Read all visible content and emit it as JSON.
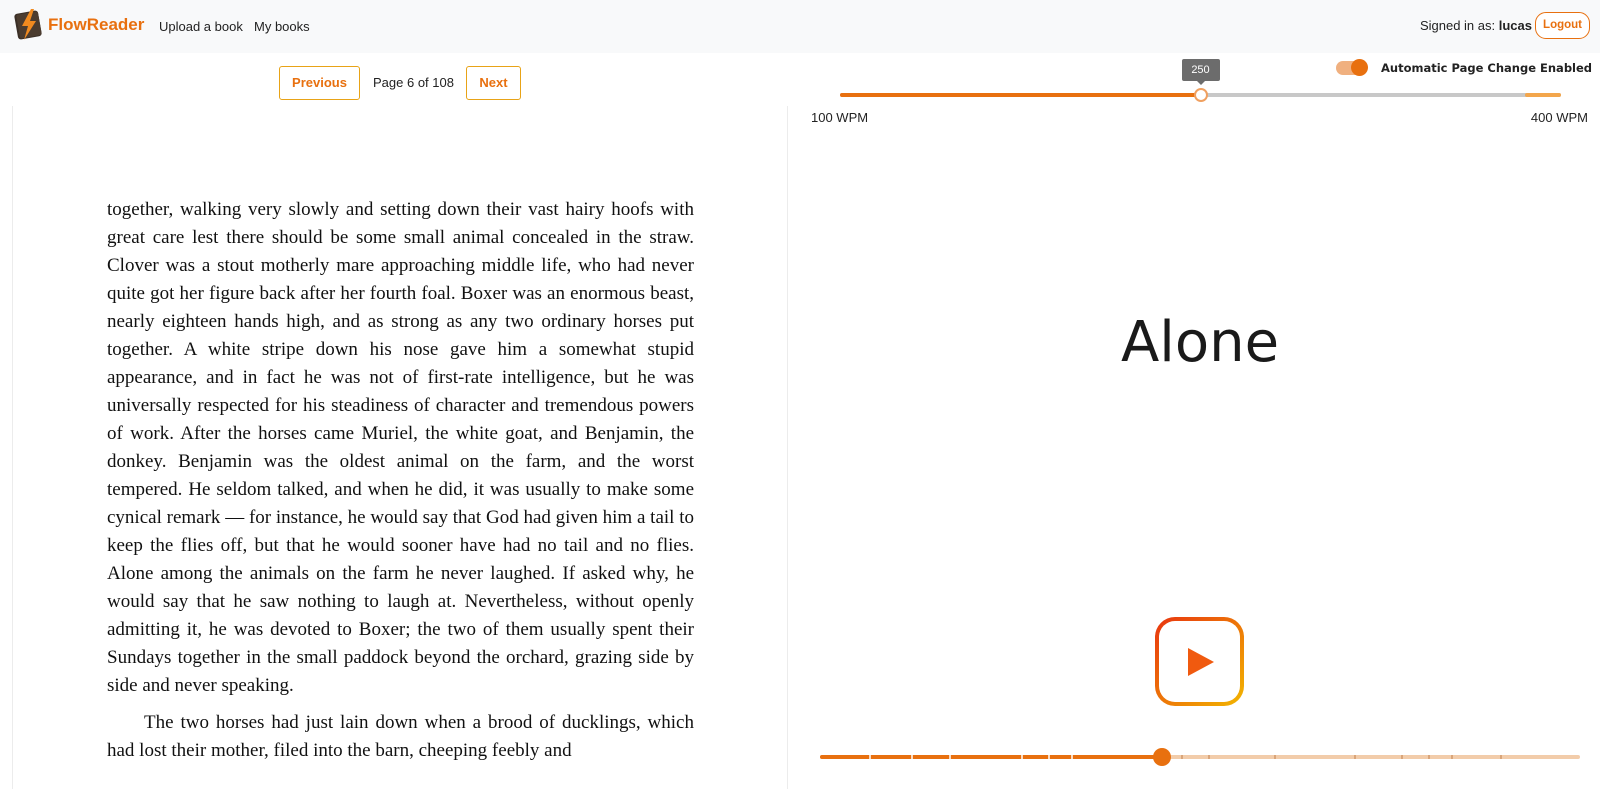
{
  "app": {
    "name": "FlowReader"
  },
  "nav": {
    "upload": "Upload a book",
    "my_books": "My books"
  },
  "user": {
    "signed_in_label": "Signed in as:",
    "username": "lucas",
    "logout_label": "Logout"
  },
  "pager": {
    "previous_label": "Previous",
    "next_label": "Next",
    "page_text": "Page 6 of 108"
  },
  "auto_page": {
    "label": "Automatic Page Change Enabled",
    "enabled": true
  },
  "speed": {
    "value": 250,
    "value_text": "250",
    "min": 100,
    "max": 400,
    "min_label": "100 WPM",
    "max_label": "400 WPM"
  },
  "reader": {
    "current_word": "Alone"
  },
  "progress": {
    "fraction": 0.45,
    "markers": [
      0.065,
      0.12,
      0.17,
      0.265,
      0.3,
      0.33,
      0.475,
      0.51,
      0.598,
      0.703,
      0.765,
      0.8,
      0.83,
      0.895
    ]
  },
  "book": {
    "paragraphs": [
      "together, walking very slowly and setting down their vast hairy hoofs with great care lest there should be some small animal concealed in the straw. Clover was a stout motherly mare approaching middle life, who had never quite got her figure back after her fourth foal. Boxer was an enormous beast, nearly eighteen hands high, and as strong as any two ordinary horses put together. A white stripe down his nose gave him a somewhat stupid appearance, and in fact he was not of first-rate intelligence, but he was universally respected for his steadiness of character and tremendous powers of work. After the horses came Muriel, the white goat, and Benjamin, the donkey. Benjamin was the oldest animal on the farm, and the worst tempered. He seldom talked, and when he did, it was usually to make some cynical remark — for instance, he would say that God had given him a tail to keep the flies off, but that he would sooner have had no tail and no flies. Alone among the animals on the farm he never laughed. If asked why, he would say that he saw nothing to laugh at. Nevertheless, without openly admitting it, he was devoted to Boxer; the two of them usually spent their Sundays together in the small paddock beyond the orchard, grazing side by side and never speaking.",
      "The two horses had just lain down when a brood of ducklings, which had lost their mother, filed into the barn, cheeping feebly and"
    ]
  },
  "colors": {
    "accent": "#e8700f",
    "accent_light": "#f0b07f",
    "gradient_start": "#e8340f",
    "gradient_end": "#f2b600"
  }
}
